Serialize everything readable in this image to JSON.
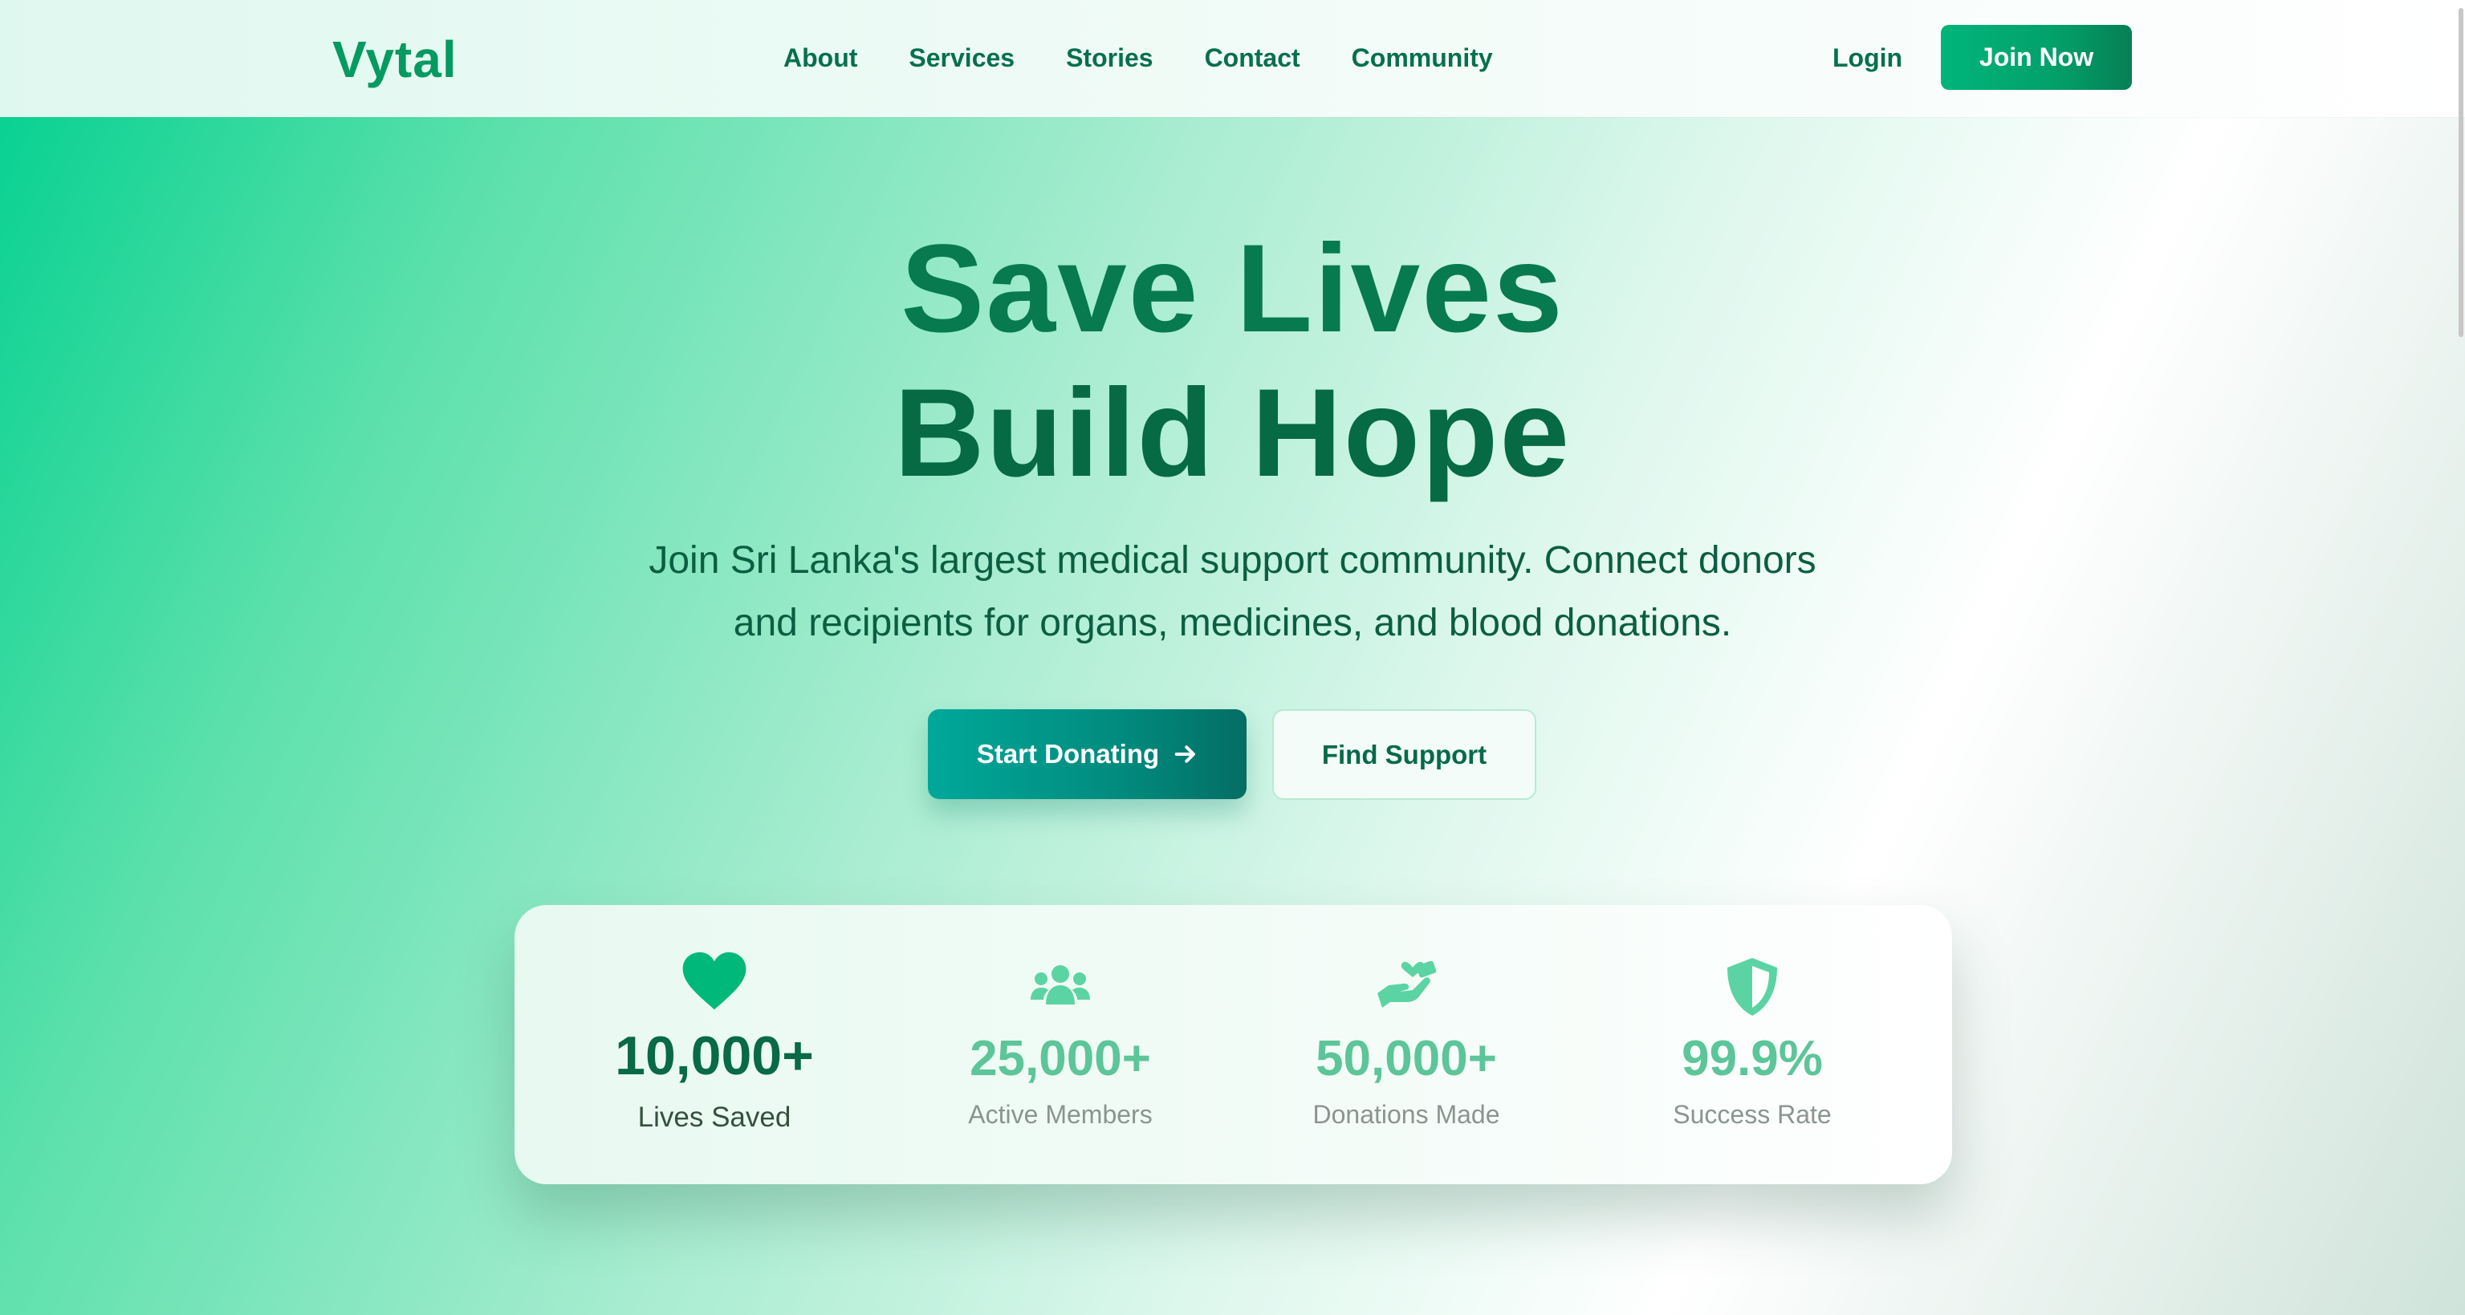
{
  "brand": {
    "name": "Vytal"
  },
  "nav": {
    "items": [
      {
        "label": "About"
      },
      {
        "label": "Services"
      },
      {
        "label": "Stories"
      },
      {
        "label": "Contact"
      },
      {
        "label": "Community"
      }
    ],
    "login_label": "Login",
    "join_label": "Join Now"
  },
  "hero": {
    "title_line1": "Save Lives",
    "title_line2": "Build Hope",
    "subtitle_line1": "Join Sri Lanka's largest medical support community. Connect donors",
    "subtitle_line2": "and recipients for organs, medicines, and blood donations.",
    "primary_button_label": "Start Donating",
    "primary_button_icon": "arrow-right-icon",
    "secondary_button_label": "Find Support"
  },
  "stats": [
    {
      "icon": "heart-icon",
      "value": "10,000+",
      "label": "Lives Saved"
    },
    {
      "icon": "users-icon",
      "value": "25,000+",
      "label": "Active Members"
    },
    {
      "icon": "hand-holding-heart-icon",
      "value": "50,000+",
      "label": "Donations Made"
    },
    {
      "icon": "shield-icon",
      "value": "99.9%",
      "label": "Success Rate"
    }
  ],
  "colors": {
    "primary_green": "#049a62",
    "dark_green": "#066a45",
    "teal_button": "#018b7e",
    "stat_accent": "#5cc59a",
    "heart": "#00b87a"
  }
}
